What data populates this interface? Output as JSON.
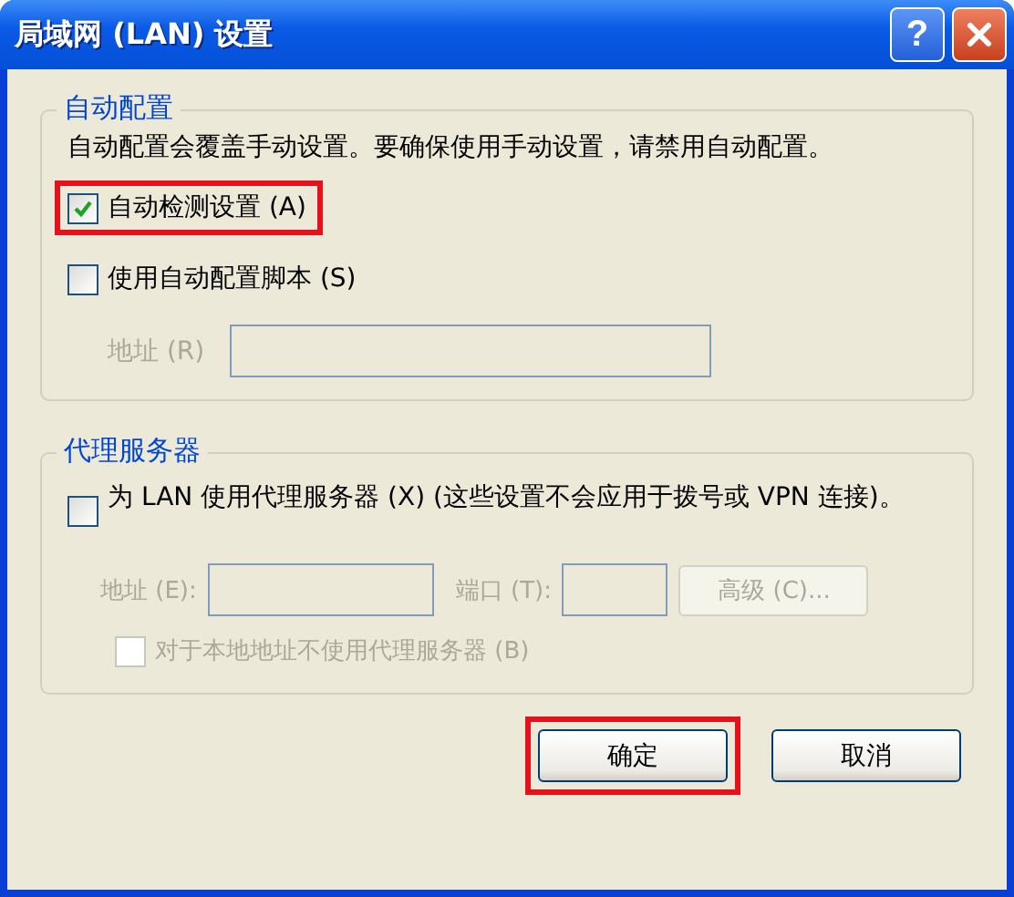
{
  "window": {
    "title": "局域网 (LAN) 设置",
    "help_label": "?"
  },
  "auto_config": {
    "title": "自动配置",
    "description": "自动配置会覆盖手动设置。要确保使用手动设置，请禁用自动配置。",
    "options": [
      {
        "label": "自动检测设置 (A)",
        "checked": true,
        "highlighted": true
      },
      {
        "label": "使用自动配置脚本 (S)",
        "checked": false,
        "highlighted": false
      }
    ],
    "address": {
      "label": "地址 (R)",
      "disabled": true
    }
  },
  "proxy": {
    "title": "代理服务器",
    "option": {
      "label": "为 LAN 使用代理服务器 (X) (这些设置不会应用于拨号或 VPN 连接)。",
      "checked": false
    },
    "address": {
      "label": "地址 (E):",
      "disabled": true
    },
    "port": {
      "label": "端口 (T):",
      "disabled": true
    },
    "advanced": {
      "label": "高级 (C)...",
      "disabled": true
    },
    "bypass": {
      "label": "对于本地地址不使用代理服务器 (B)",
      "checked": false,
      "disabled": true
    }
  },
  "buttons": [
    {
      "label": "确定",
      "highlighted": true
    },
    {
      "label": "取消",
      "highlighted": false
    }
  ]
}
